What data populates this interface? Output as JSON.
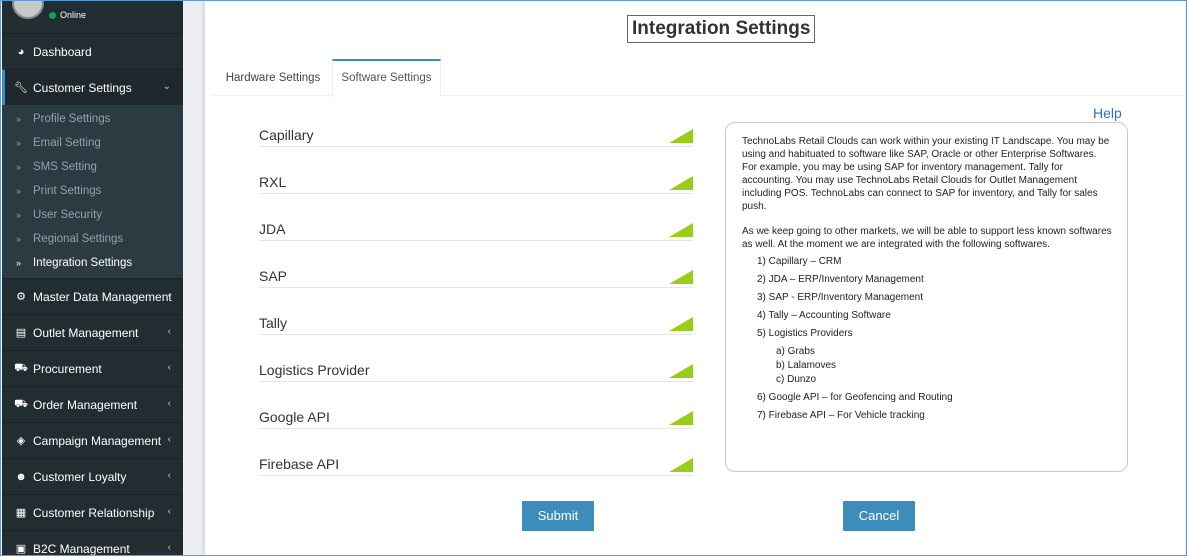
{
  "user_panel": {
    "status": "Online"
  },
  "sidebar": {
    "dashboard": "Dashboard",
    "customer_settings": "Customer Settings",
    "sub_items": [
      "Profile Settings",
      "Email Setting",
      "SMS Setting",
      "Print Settings",
      "User Security",
      "Regional Settings",
      "Integration Settings"
    ],
    "menu": [
      "Master Data Management",
      "Outlet Management",
      "Procurement",
      "Order Management",
      "Campaign Management",
      "Customer Loyalty",
      "Customer Relationship",
      "B2C Management"
    ]
  },
  "page": {
    "title": "Integration Settings",
    "help": "Help"
  },
  "tabs": [
    "Hardware Settings",
    "Software Settings"
  ],
  "software_items": [
    "Capillary",
    "RXL",
    "JDA",
    "SAP",
    "Tally",
    "Logistics Provider",
    "Google API",
    "Firebase API"
  ],
  "help_text": {
    "para1": "TechnoLabs Retail Clouds can work within your existing IT Landscape. You may be using and habituated to software like SAP, Oracle or other Enterprise Softwares. For example, you may be using SAP for inventory management. Tally for accounting. You may use TechnoLabs Retail Clouds for Outlet Management including POS. TechnoLabs can connect to SAP for inventory, and Tally for sales push.",
    "para2": "As we keep going to other markets, we will be able to support less known softwares as well. At the moment we are integrated with the following softwares.",
    "list": [
      "1)    Capillary – CRM",
      "2)    JDA – ERP/Inventory Management",
      "3)    SAP -  ERP/Inventory Management",
      "4)    Tally – Accounting Software",
      "5)    Logistics Providers"
    ],
    "sub_list": [
      "a)    Grabs",
      "b)    Lalamoves",
      "c)    Dunzo"
    ],
    "list2": [
      "6)    Google API – for Geofencing and Routing",
      "7)    Firebase API – For Vehicle tracking"
    ]
  },
  "buttons": {
    "submit": "Submit",
    "cancel": "Cancel"
  },
  "colors": {
    "sidebar": "#222d32",
    "accent": "#3c8dbc",
    "flag": "#9acd1a"
  }
}
